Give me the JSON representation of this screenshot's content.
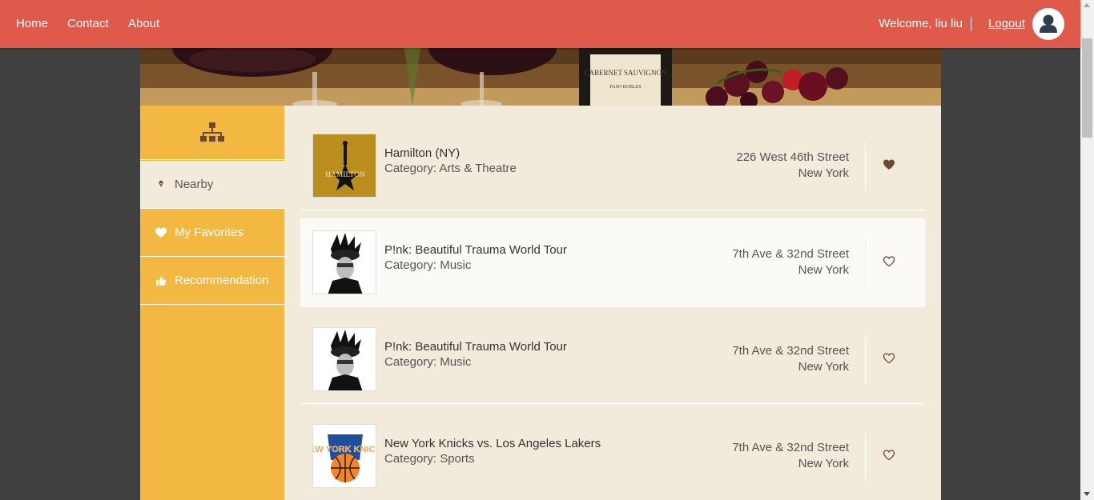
{
  "nav": {
    "home": "Home",
    "contact": "Contact",
    "about": "About",
    "welcome": "Welcome, liu liu",
    "logout": "Logout",
    "avatar_icon": "user-icon"
  },
  "banner": {
    "bottle_label": "CABERNET SAUVIGNON",
    "bottle_sublabel": "PASO ROBLES"
  },
  "sidebar": {
    "top_icon": "sitemap-icon",
    "items": [
      {
        "label": "Nearby",
        "icon": "map-marker-icon",
        "active": true
      },
      {
        "label": "My Favorites",
        "icon": "heart-icon",
        "active": false
      },
      {
        "label": "Recommendation",
        "icon": "thumbs-up-icon",
        "active": false
      }
    ]
  },
  "items": [
    {
      "name": "Hamilton (NY)",
      "category": "Category: Arts & Theatre",
      "address_line1": "226 West 46th Street",
      "address_line2": "New York",
      "favorite": true,
      "thumb_text": "HAMILTON"
    },
    {
      "name": "P!nk: Beautiful Trauma World Tour",
      "category": "Category: Music",
      "address_line1": "7th Ave & 32nd Street",
      "address_line2": "New York",
      "favorite": false
    },
    {
      "name": "P!nk: Beautiful Trauma World Tour",
      "category": "Category: Music",
      "address_line1": "7th Ave & 32nd Street",
      "address_line2": "New York",
      "favorite": false
    },
    {
      "name": "New York Knicks vs. Los Angeles Lakers",
      "category": "Category: Sports",
      "address_line1": "7th Ave & 32nd Street",
      "address_line2": "New York",
      "favorite": false,
      "thumb_text": "NEW YORK KNICKS"
    }
  ],
  "colors": {
    "header": "#e05a4b",
    "sidebar": "#f2b841",
    "main_bg": "#f2eadb",
    "heart": "#6b4a2f"
  }
}
